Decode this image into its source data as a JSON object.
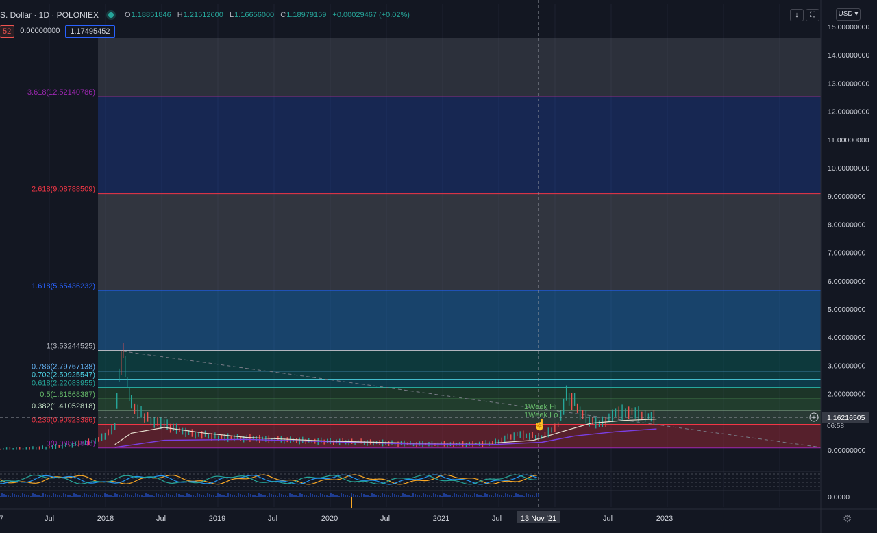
{
  "header": {
    "symbol": "S. Dollar · 1D · POLONIEX",
    "ohlc": [
      {
        "k": "O",
        "v": "1.18851846"
      },
      {
        "k": "H",
        "v": "1.21512600"
      },
      {
        "k": "L",
        "v": "1.16656000"
      },
      {
        "k": "C",
        "v": "1.18979159"
      }
    ],
    "change": "+0.00029467 (+0.02%)"
  },
  "indicator_values": {
    "red": "52",
    "plain": "0.00000000",
    "blue": "1.17495452"
  },
  "toolbar": {
    "currency": "USD",
    "download_icon": "arrow-down-icon",
    "fullscreen_icon": "fullscreen-icon",
    "settings_icon": "gear-icon"
  },
  "colors": {
    "background": "#131722",
    "candle_up": "#26a69a",
    "candle_down": "#ef5350",
    "ma_light": "#e8e0d0",
    "ma_purple": "#7b3fe4",
    "fib_purple": "#9c27b0",
    "fib_red": "#f23645",
    "fib_blue": "#2962ff",
    "fib_teal": "#00897b",
    "fib_green": "#4caf50"
  },
  "chart_data": {
    "type": "line",
    "x_ticks": [
      "7",
      "Jul",
      "2018",
      "Jul",
      "2019",
      "Jul",
      "2020",
      "Jul",
      "2021",
      "Jul",
      "13 Nov '21",
      "Jul",
      "2023"
    ],
    "crosshair_date": "13 Nov '21",
    "y_ticks": [
      "15.00000000",
      "14.00000000",
      "13.00000000",
      "12.00000000",
      "11.00000000",
      "10.00000000",
      "9.00000000",
      "8.00000000",
      "7.00000000",
      "6.00000000",
      "5.00000000",
      "4.00000000",
      "3.00000000",
      "2.00000000",
      "1.00000000",
      "0.00000000"
    ],
    "ylim": [
      0,
      15
    ],
    "fib_levels": [
      {
        "ratio": "",
        "value": 14.6,
        "label": ""
      },
      {
        "ratio": "3.618",
        "value": 12.5214078,
        "label": "3.618(12.52140786)"
      },
      {
        "ratio": "2.618",
        "value": 9.08788509,
        "label": "2.618(9.08788509)"
      },
      {
        "ratio": "1.618",
        "value": 5.65436232,
        "label": "1.618(5.65436232)"
      },
      {
        "ratio": "1",
        "value": 3.53244525,
        "label": "1(3.53244525)"
      },
      {
        "ratio": "0.786",
        "value": 2.79767138,
        "label": "0.786(2.79767138)"
      },
      {
        "ratio": "0.702",
        "value": 2.50925547,
        "label": "0.702(2.50925547)"
      },
      {
        "ratio": "0.618",
        "value": 2.22083955,
        "label": "0.618(2.22083955)"
      },
      {
        "ratio": "0.5",
        "value": 1.81568387,
        "label": "0.5(1.81568387)"
      },
      {
        "ratio": "0.382",
        "value": 1.41052818,
        "label": "0.382(1.41052818)"
      },
      {
        "ratio": "0.236",
        "value": 0.90923386,
        "label": "0.236(0.90923386)"
      },
      {
        "ratio": "0",
        "value": 0.08,
        "label": "0(0.08893846)"
      }
    ],
    "price_path": [
      [
        0,
        0.02
      ],
      [
        0.04,
        0.05
      ],
      [
        0.08,
        0.15
      ],
      [
        0.12,
        0.35
      ],
      [
        0.14,
        0.8
      ],
      [
        0.145,
        2.6
      ],
      [
        0.15,
        3.5
      ],
      [
        0.155,
        2.4
      ],
      [
        0.16,
        1.6
      ],
      [
        0.18,
        1.1
      ],
      [
        0.2,
        0.9
      ],
      [
        0.23,
        0.6
      ],
      [
        0.27,
        0.45
      ],
      [
        0.32,
        0.4
      ],
      [
        0.38,
        0.32
      ],
      [
        0.44,
        0.28
      ],
      [
        0.5,
        0.22
      ],
      [
        0.56,
        0.2
      ],
      [
        0.6,
        0.25
      ],
      [
        0.63,
        0.55
      ],
      [
        0.66,
        0.45
      ],
      [
        0.68,
        0.9
      ],
      [
        0.69,
        1.9
      ],
      [
        0.7,
        1.7
      ],
      [
        0.71,
        1.2
      ],
      [
        0.73,
        0.9
      ],
      [
        0.75,
        1.3
      ],
      [
        0.77,
        1.35
      ],
      [
        0.79,
        1.2
      ],
      [
        0.8,
        1.18
      ]
    ],
    "ma_light_path": [
      [
        0.14,
        0.2
      ],
      [
        0.16,
        0.6
      ],
      [
        0.2,
        0.8
      ],
      [
        0.25,
        0.6
      ],
      [
        0.3,
        0.45
      ],
      [
        0.4,
        0.32
      ],
      [
        0.5,
        0.25
      ],
      [
        0.6,
        0.25
      ],
      [
        0.65,
        0.35
      ],
      [
        0.69,
        0.7
      ],
      [
        0.72,
        0.95
      ],
      [
        0.76,
        1.05
      ],
      [
        0.8,
        1.1
      ]
    ],
    "ma_purple_path": [
      [
        0.14,
        0.1
      ],
      [
        0.2,
        0.35
      ],
      [
        0.3,
        0.38
      ],
      [
        0.4,
        0.3
      ],
      [
        0.5,
        0.22
      ],
      [
        0.6,
        0.2
      ],
      [
        0.66,
        0.28
      ],
      [
        0.7,
        0.5
      ],
      [
        0.75,
        0.65
      ],
      [
        0.8,
        0.75
      ]
    ],
    "trendline": [
      [
        0.15,
        3.5
      ],
      [
        1.0,
        0.1
      ]
    ],
    "annotations": [
      "1Week Hi",
      "1Week Lo"
    ],
    "current_price": "1.16216505",
    "countdown": "06:58",
    "lower_pane": {
      "tick": "0.0000"
    }
  }
}
